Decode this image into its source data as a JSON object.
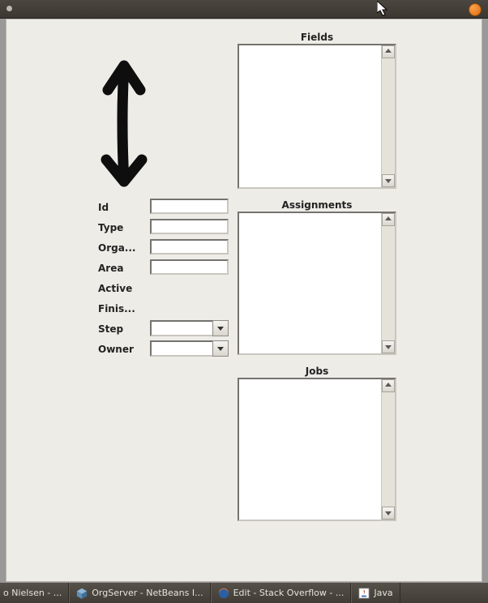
{
  "groups": {
    "fields": "Fields",
    "assignments": "Assignments",
    "jobs": "Jobs"
  },
  "form": {
    "id": {
      "label": "Id",
      "value": ""
    },
    "type": {
      "label": "Type",
      "value": ""
    },
    "orga": {
      "label": "Orga...",
      "value": ""
    },
    "area": {
      "label": "Area",
      "value": ""
    },
    "active": {
      "label": "Active"
    },
    "finis": {
      "label": "Finis..."
    },
    "step": {
      "label": "Step",
      "value": ""
    },
    "owner": {
      "label": "Owner",
      "value": ""
    }
  },
  "lists": {
    "fields": [],
    "assignments": [],
    "jobs": []
  },
  "taskbar": [
    {
      "label": "o Nielsen - ..."
    },
    {
      "label": "OrgServer - NetBeans I..."
    },
    {
      "label": "Edit - Stack Overflow - ..."
    },
    {
      "label": "Java"
    }
  ]
}
